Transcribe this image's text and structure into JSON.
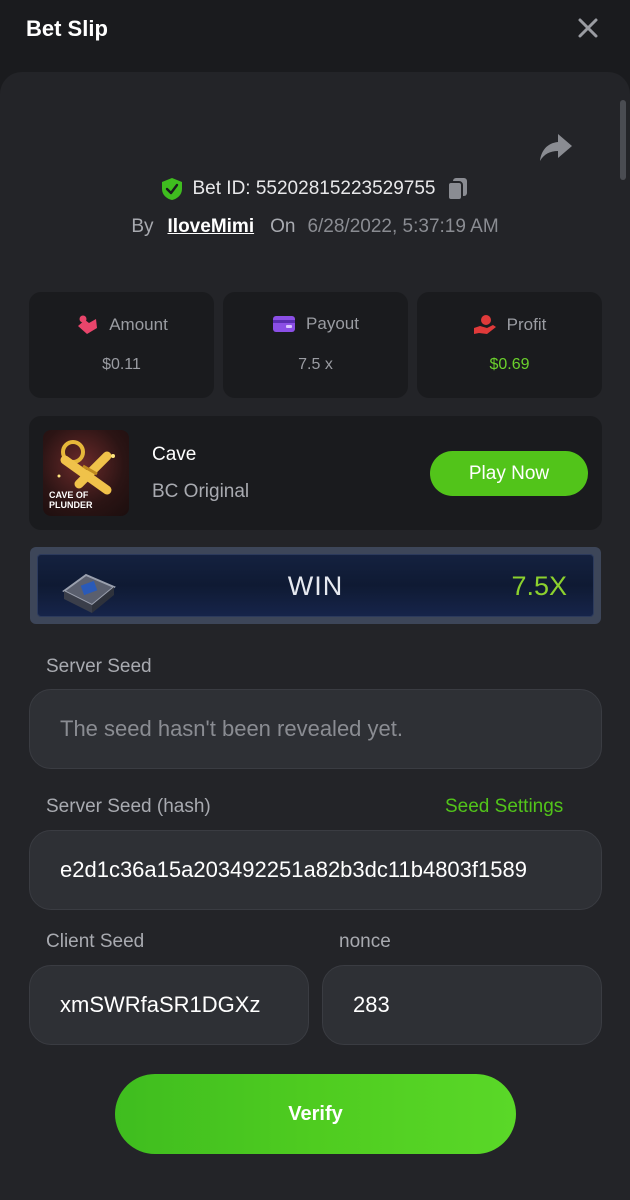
{
  "header": {
    "title": "Bet Slip"
  },
  "bet": {
    "id_label": "Bet ID: 55202815223529755",
    "by_label": "By",
    "username": "IloveMimi",
    "on_label": "On",
    "date": "6/28/2022, 5:37:19 AM"
  },
  "stats": [
    {
      "label": "Amount",
      "value": "$0.11",
      "icon": "coins-icon",
      "color": "#e8456b"
    },
    {
      "label": "Payout",
      "value": "7.5 x",
      "icon": "wallet-icon",
      "color": "#8b4fe6"
    },
    {
      "label": "Profit",
      "value": "$0.69",
      "icon": "hand-coin-icon",
      "color": "#e03a3a"
    }
  ],
  "game": {
    "name": "Cave",
    "provider": "BC Original",
    "thumb_text": "CAVE OF PLUNDER",
    "play_label": "Play Now"
  },
  "result": {
    "label": "WIN",
    "multiplier": "7.5X"
  },
  "server_seed": {
    "label": "Server Seed",
    "value": "The seed hasn't been revealed yet."
  },
  "server_seed_hash": {
    "label": "Server Seed (hash)",
    "link": "Seed Settings",
    "value": "e2d1c36a15a203492251a82b3dc11b4803f1589"
  },
  "client_seed": {
    "label": "Client Seed",
    "value": "xmSWRfaSR1DGXz"
  },
  "nonce": {
    "label": "nonce",
    "value": "283"
  },
  "verify_label": "Verify",
  "colors": {
    "accent": "#52c41a",
    "background": "#1a1b1e",
    "panel": "#232428"
  }
}
